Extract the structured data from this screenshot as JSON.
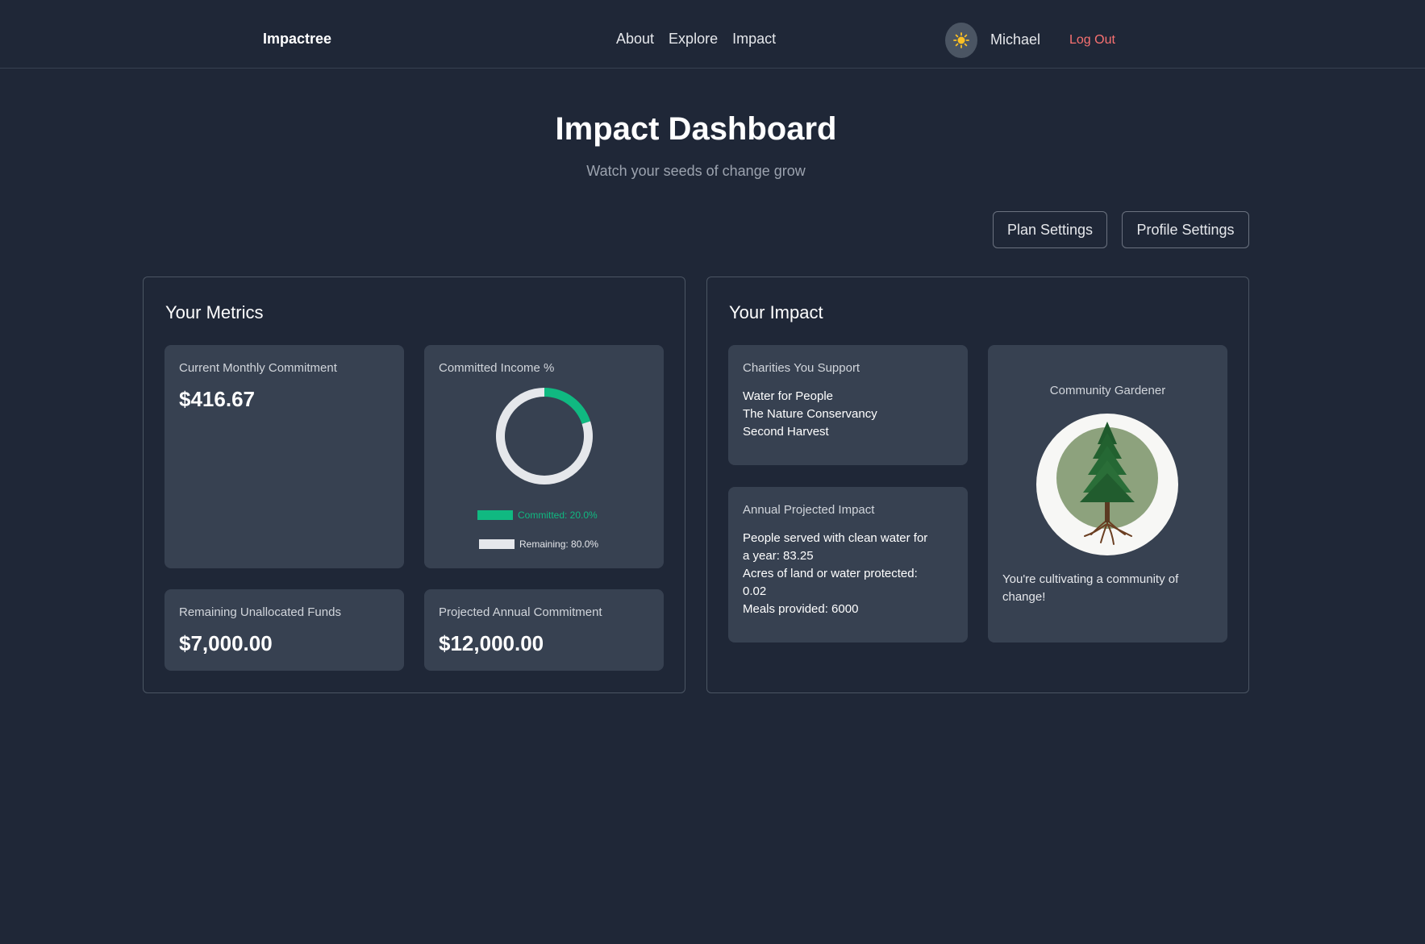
{
  "nav": {
    "brand": "Impactree",
    "links": [
      "About",
      "Explore",
      "Impact"
    ],
    "theme_icon": "sun-icon",
    "username": "Michael",
    "logout": "Log Out"
  },
  "hero": {
    "title": "Impact Dashboard",
    "subtitle": "Watch your seeds of change grow"
  },
  "actions": {
    "plan_settings": "Plan Settings",
    "profile_settings": "Profile Settings"
  },
  "metrics": {
    "title": "Your Metrics",
    "monthly_label": "Current Monthly Commitment",
    "monthly_value": "$416.67",
    "income_label": "Committed Income %",
    "committed_legend": "Committed: 20.0%",
    "remaining_legend": "Remaining: 80.0%",
    "unallocated_label": "Remaining Unallocated Funds",
    "unallocated_value": "$7,000.00",
    "annual_label": "Projected Annual Commitment",
    "annual_value": "$12,000.00"
  },
  "chart_data": {
    "type": "pie",
    "categories": [
      "Committed",
      "Remaining"
    ],
    "values": [
      20.0,
      80.0
    ],
    "colors": [
      "#10b981",
      "#e5e7eb"
    ]
  },
  "impact": {
    "title": "Your Impact",
    "charities_label": "Charities You Support",
    "charities": [
      "Water for People",
      "The Nature Conservancy",
      "Second Harvest"
    ],
    "annual_label": "Annual Projected Impact",
    "annual_lines": [
      "People served with clean water for",
      "a year: 83.25",
      "Acres of land or water protected:",
      "0.02",
      "Meals provided: 6000"
    ],
    "badge_title": "Community Gardener",
    "badge_message": "You're cultivating a community of change!"
  }
}
